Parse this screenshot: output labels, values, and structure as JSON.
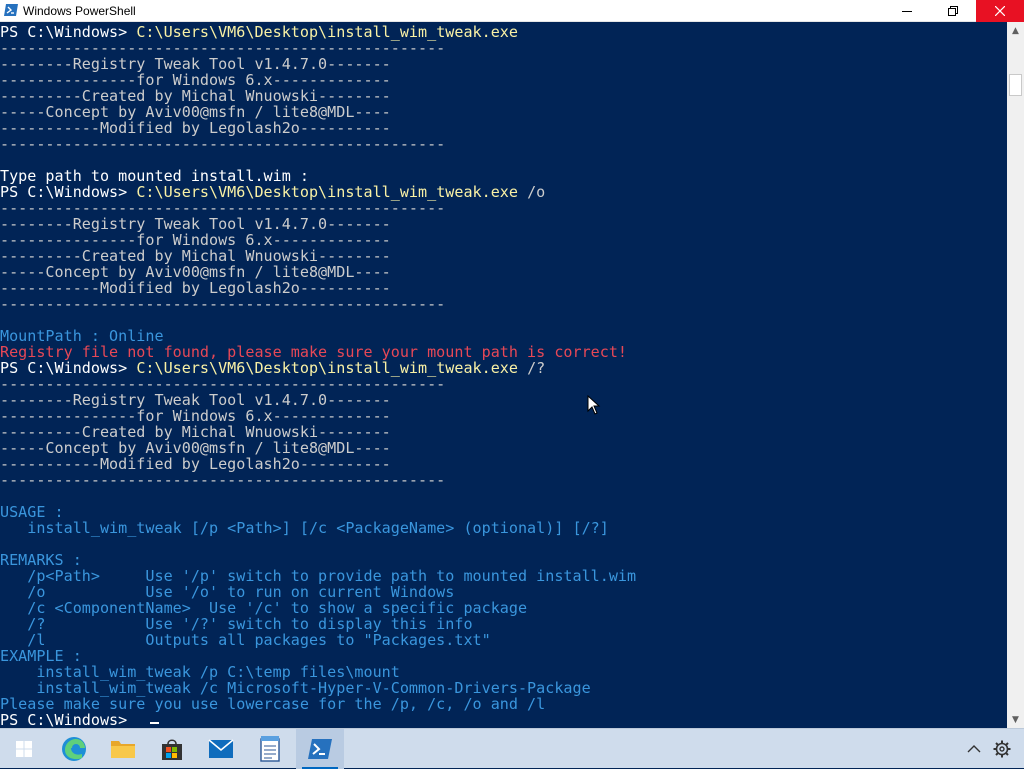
{
  "window": {
    "title": "Windows PowerShell"
  },
  "colors": {
    "console_bg": "#012456",
    "prompt_path": "#f9f1a5",
    "error_red": "#e74856",
    "info_cyan": "#3a96dd",
    "close_button": "#e81123"
  },
  "titlebar_icons": {
    "app": "powershell-icon",
    "minimize": "minimize-icon",
    "maximize": "maximize-icon",
    "close": "close-icon"
  },
  "console": {
    "lines": [
      [
        {
          "t": "PS C:\\Windows> ",
          "c": "white"
        },
        {
          "t": "C:\\Users\\VM6\\Desktop\\install_wim_tweak.exe",
          "c": "yellow"
        }
      ],
      [
        {
          "t": "-------------------------------------------------",
          "c": "gray"
        }
      ],
      [
        {
          "t": "--------Registry Tweak Tool v1.4.7.0-------",
          "c": "gray"
        }
      ],
      [
        {
          "t": "---------------for Windows 6.x-------------",
          "c": "gray"
        }
      ],
      [
        {
          "t": "---------Created by Michal Wnuowski--------",
          "c": "gray"
        }
      ],
      [
        {
          "t": "-----Concept by Aviv00@msfn / lite8@MDL----",
          "c": "gray"
        }
      ],
      [
        {
          "t": "-----------Modified by Legolash2o----------",
          "c": "gray"
        }
      ],
      [
        {
          "t": "-------------------------------------------------",
          "c": "gray"
        }
      ],
      [
        {
          "t": "",
          "c": "gray"
        }
      ],
      [
        {
          "t": "Type path to mounted install.wim :",
          "c": "white"
        }
      ],
      [
        {
          "t": "PS C:\\Windows> ",
          "c": "white"
        },
        {
          "t": "C:\\Users\\VM6\\Desktop\\install_wim_tweak.exe",
          "c": "yellow"
        },
        {
          "t": " /o",
          "c": "gray"
        }
      ],
      [
        {
          "t": "-------------------------------------------------",
          "c": "gray"
        }
      ],
      [
        {
          "t": "--------Registry Tweak Tool v1.4.7.0-------",
          "c": "gray"
        }
      ],
      [
        {
          "t": "---------------for Windows 6.x-------------",
          "c": "gray"
        }
      ],
      [
        {
          "t": "---------Created by Michal Wnuowski--------",
          "c": "gray"
        }
      ],
      [
        {
          "t": "-----Concept by Aviv00@msfn / lite8@MDL----",
          "c": "gray"
        }
      ],
      [
        {
          "t": "-----------Modified by Legolash2o----------",
          "c": "gray"
        }
      ],
      [
        {
          "t": "-------------------------------------------------",
          "c": "gray"
        }
      ],
      [
        {
          "t": "",
          "c": "gray"
        }
      ],
      [
        {
          "t": "MountPath : Online",
          "c": "cyan"
        }
      ],
      [
        {
          "t": "Registry file not found, please make sure your mount path is correct!",
          "c": "red"
        }
      ],
      [
        {
          "t": "PS C:\\Windows> ",
          "c": "white"
        },
        {
          "t": "C:\\Users\\VM6\\Desktop\\install_wim_tweak.exe",
          "c": "yellow"
        },
        {
          "t": " /?",
          "c": "gray"
        }
      ],
      [
        {
          "t": "-------------------------------------------------",
          "c": "gray"
        }
      ],
      [
        {
          "t": "--------Registry Tweak Tool v1.4.7.0-------",
          "c": "gray"
        }
      ],
      [
        {
          "t": "---------------for Windows 6.x-------------",
          "c": "gray"
        }
      ],
      [
        {
          "t": "---------Created by Michal Wnuowski--------",
          "c": "gray"
        }
      ],
      [
        {
          "t": "-----Concept by Aviv00@msfn / lite8@MDL----",
          "c": "gray"
        }
      ],
      [
        {
          "t": "-----------Modified by Legolash2o----------",
          "c": "gray"
        }
      ],
      [
        {
          "t": "-------------------------------------------------",
          "c": "gray"
        }
      ],
      [
        {
          "t": "",
          "c": "gray"
        }
      ],
      [
        {
          "t": "USAGE :",
          "c": "cyan"
        }
      ],
      [
        {
          "t": "   install_wim_tweak [/p <Path>] [/c <PackageName> (optional)] [/?]",
          "c": "cyan"
        }
      ],
      [
        {
          "t": "",
          "c": "gray"
        }
      ],
      [
        {
          "t": "REMARKS :",
          "c": "cyan"
        }
      ],
      [
        {
          "t": "   /p<Path>     Use '/p' switch to provide path to mounted install.wim",
          "c": "cyan"
        }
      ],
      [
        {
          "t": "   /o           Use '/o' to run on current Windows",
          "c": "cyan"
        }
      ],
      [
        {
          "t": "   /c <ComponentName>  Use '/c' to show a specific package",
          "c": "cyan"
        }
      ],
      [
        {
          "t": "   /?           Use '/?' switch to display this info",
          "c": "cyan"
        }
      ],
      [
        {
          "t": "   /l           Outputs all packages to \"Packages.txt\"",
          "c": "cyan"
        }
      ],
      [
        {
          "t": "EXAMPLE :",
          "c": "cyan"
        }
      ],
      [
        {
          "t": "    install_wim_tweak /p C:\\temp files\\mount",
          "c": "cyan"
        }
      ],
      [
        {
          "t": "    install_wim_tweak /c Microsoft-Hyper-V-Common-Drivers-Package",
          "c": "cyan"
        }
      ],
      [
        {
          "t": "Please make sure you use lowercase for the /p, /c, /o and /l",
          "c": "cyan"
        }
      ],
      [
        {
          "t": "PS C:\\Windows> ",
          "c": "white"
        }
      ]
    ]
  },
  "scrollbar": {
    "up_icon": "scroll-up-icon",
    "down_icon": "scroll-down-icon"
  },
  "taskbar": {
    "items": [
      {
        "name": "start-button",
        "icon": "windows-logo-icon"
      },
      {
        "name": "edge-button",
        "icon": "edge-icon"
      },
      {
        "name": "file-explorer-button",
        "icon": "folder-icon"
      },
      {
        "name": "store-button",
        "icon": "store-bag-icon"
      },
      {
        "name": "mail-button",
        "icon": "mail-icon"
      },
      {
        "name": "notepad-button",
        "icon": "notepad-icon"
      },
      {
        "name": "powershell-taskbar-button",
        "icon": "powershell-icon",
        "active": true
      }
    ],
    "tray": [
      {
        "name": "show-hidden-icons-button",
        "icon": "chevron-up-icon"
      },
      {
        "name": "settings-button",
        "icon": "gear-icon"
      }
    ]
  }
}
